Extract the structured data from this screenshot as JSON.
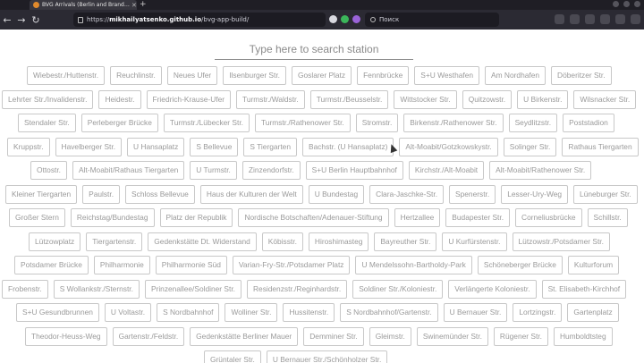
{
  "browser": {
    "tab_title": "BVG Arrivals (Berlin and Brand…",
    "url_prefix": "https://",
    "url_host": "mikhailyatsenko.github.io",
    "url_path": "/bvg-app-build/",
    "search_placeholder": "Поиск"
  },
  "search": {
    "placeholder": "Type here to search station"
  },
  "rows": [
    [
      "Wiebestr./Huttenstr.",
      "Reuchlinstr.",
      "Neues Ufer",
      "Ilsenburger Str.",
      "Goslarer Platz",
      "Fennbrücke",
      "S+U Westhafen",
      "Am Nordhafen",
      "Döberitzer Str."
    ],
    [
      "Lehrter Str./Invalidenstr.",
      "Heidestr.",
      "Friedrich-Krause-Ufer",
      "Turmstr./Waldstr.",
      "Turmstr./Beusselstr.",
      "Wittstocker Str.",
      "Quitzowstr.",
      "U Birkenstr.",
      "Wilsnacker Str."
    ],
    [
      "Stendaler Str.",
      "Perleberger Brücke",
      "Turmstr./Lübecker Str.",
      "Turmstr./Rathenower Str.",
      "Stromstr.",
      "Birkenstr./Rathenower Str.",
      "Seydlitzstr.",
      "Poststadion"
    ],
    [
      "Kruppstr.",
      "Havelberger Str.",
      "U Hansaplatz",
      "S Bellevue",
      "S Tiergarten",
      "Bachstr. (U Hansaplatz)",
      "Alt-Moabit/Gotzkowskystr.",
      "Solinger Str.",
      "Rathaus Tiergarten"
    ],
    [
      "Ottostr.",
      "Alt-Moabit/Rathaus Tiergarten",
      "U Turmstr.",
      "Zinzendorfstr.",
      "S+U Berlin Hauptbahnhof",
      "Kirchstr./Alt-Moabit",
      "Alt-Moabit/Rathenower Str."
    ],
    [
      "Kleiner Tiergarten",
      "Paulstr.",
      "Schloss Bellevue",
      "Haus der Kulturen der Welt",
      "U Bundestag",
      "Clara-Jaschke-Str.",
      "Spenerstr.",
      "Lesser-Ury-Weg",
      "Lüneburger Str."
    ],
    [
      "Großer Stern",
      "Reichstag/Bundestag",
      "Platz der Republik",
      "Nordische Botschaften/Adenauer-Stiftung",
      "Hertzallee",
      "Budapester Str.",
      "Corneliusbrücke",
      "Schillstr."
    ],
    [
      "Lützowplatz",
      "Tiergartenstr.",
      "Gedenkstätte Dt. Widerstand",
      "Köbisstr.",
      "Hiroshimasteg",
      "Bayreuther Str.",
      "U Kurfürstenstr.",
      "Lützowstr./Potsdamer Str."
    ],
    [
      "Potsdamer Brücke",
      "Philharmonie",
      "Philharmonie Süd",
      "Varian-Fry-Str./Potsdamer Platz",
      "U Mendelssohn-Bartholdy-Park",
      "Schöneberger Brücke",
      "Kulturforum"
    ],
    [
      "Froben­str.",
      "S Wollankstr./Sternstr.",
      "Prinzenallee/Soldiner Str.",
      "Residenzstr./Reginhardstr.",
      "Soldiner Str./Koloniestr.",
      "Verlängerte Koloniestr.",
      "St. Elisabeth-Kirchhof"
    ],
    [
      "S+U Gesundbrunnen",
      "U Voltastr.",
      "S Nordbahnhof",
      "Wolliner Str.",
      "Hussitenstr.",
      "S Nordbahnhof/Gartenstr.",
      "U Bernauer Str.",
      "Lortzingstr.",
      "Gartenplatz"
    ],
    [
      "Theodor-Heuss-Weg",
      "Gartenstr./Feldstr.",
      "Gedenkstätte Berliner Mauer",
      "Demminer Str.",
      "Gleimstr.",
      "Swinemünder Str.",
      "Rügener Str.",
      "Humboldtsteg"
    ],
    [
      "Grüntaler Str.",
      "U Bernauer Str./Schönholzer Str."
    ]
  ]
}
